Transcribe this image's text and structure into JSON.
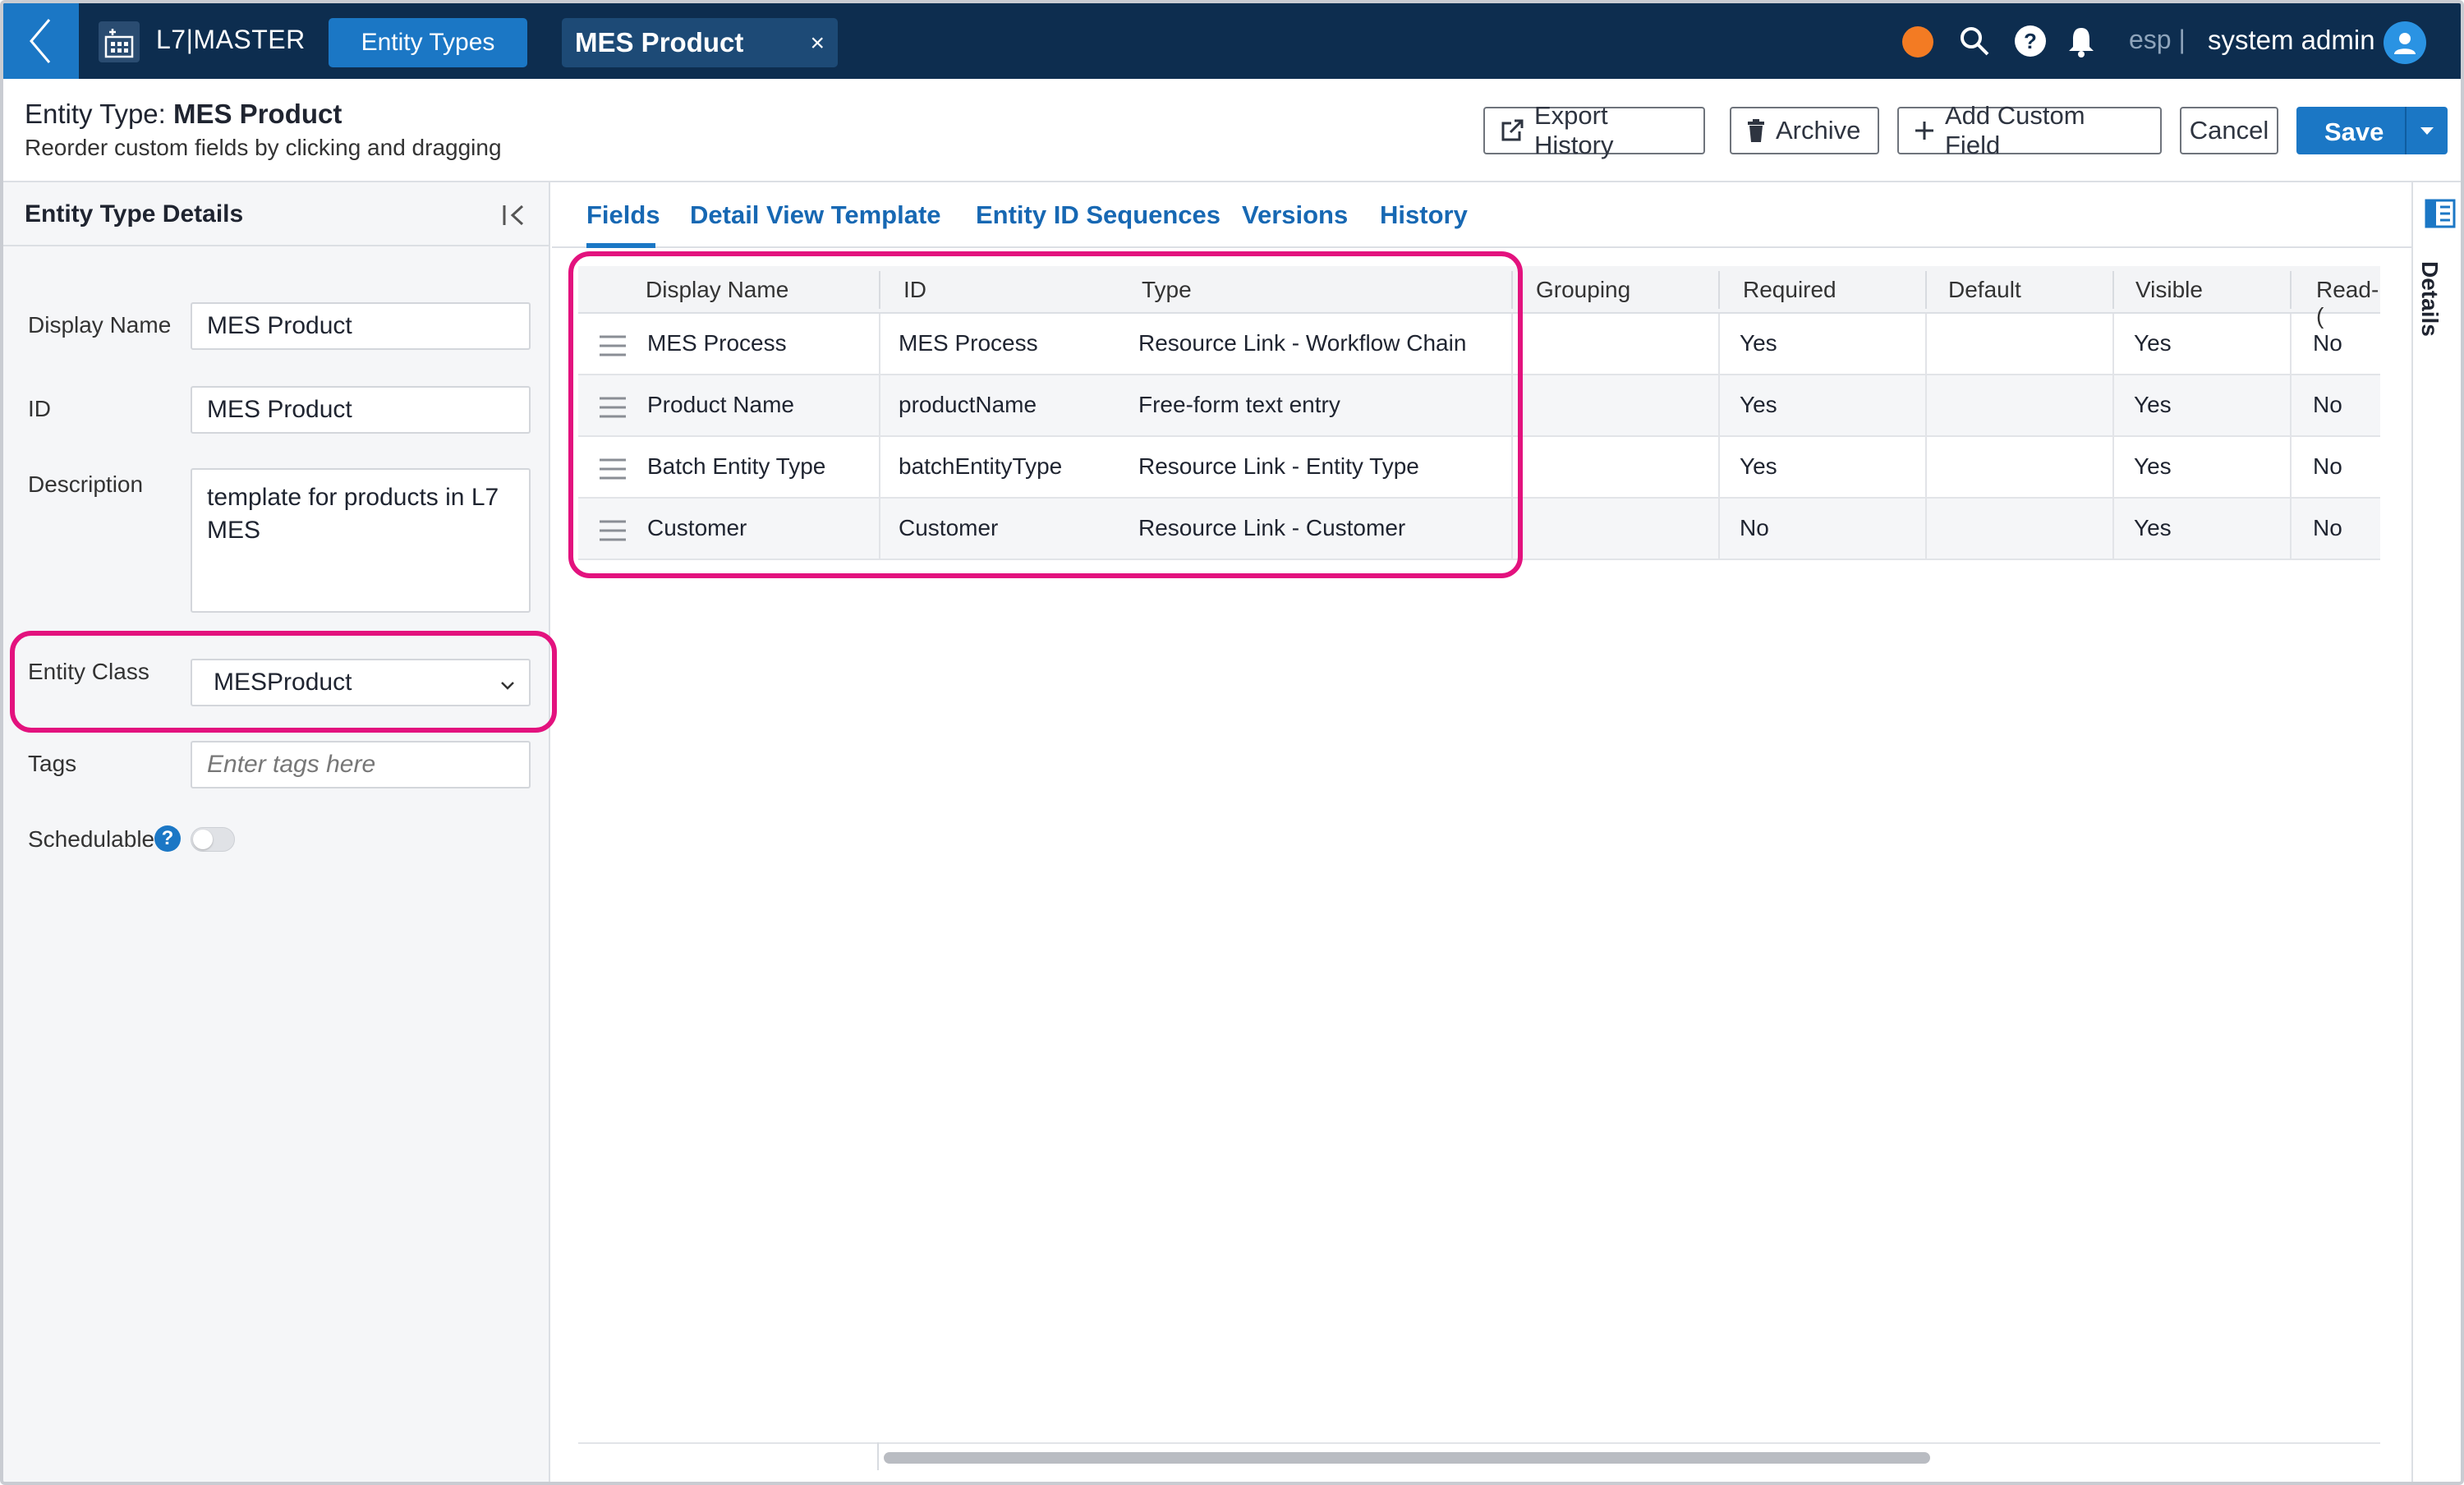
{
  "topbar": {
    "app_name": "L7|MASTER",
    "tabs": [
      {
        "label": "Entity Types"
      },
      {
        "label": "MES Product",
        "close": "×"
      }
    ],
    "lang": "esp |",
    "user": "system admin",
    "status_color": "#f37b23"
  },
  "header": {
    "title_prefix": "Entity Type:",
    "title_name": "MES Product",
    "subtitle": "Reorder custom fields by clicking and dragging",
    "buttons": {
      "export": "Export History",
      "archive": "Archive",
      "add_field": "Add Custom Field",
      "cancel": "Cancel",
      "save": "Save"
    }
  },
  "left_panel": {
    "title": "Entity Type Details",
    "fields": {
      "display_name_label": "Display Name",
      "display_name_value": "MES Product",
      "id_label": "ID",
      "id_value": "MES Product",
      "description_label": "Description",
      "description_value": "template for products in L7 MES",
      "entity_class_label": "Entity Class",
      "entity_class_value": "MESProduct",
      "tags_label": "Tags",
      "tags_placeholder": "Enter tags here",
      "schedulable_label": "Schedulable",
      "help_glyph": "?"
    }
  },
  "content_tabs": [
    "Fields",
    "Detail View Template",
    "Entity ID Sequences",
    "Versions",
    "History"
  ],
  "table": {
    "columns": [
      "Display Name",
      "ID",
      "Type",
      "Grouping",
      "Required",
      "Default",
      "Visible",
      "Read-("
    ],
    "rows": [
      {
        "display_name": "MES Process",
        "id": "MES Process",
        "type": "Resource Link - Workflow Chain",
        "grouping": "",
        "required": "Yes",
        "default": "",
        "visible": "Yes",
        "read_only": "No"
      },
      {
        "display_name": "Product Name",
        "id": "productName",
        "type": "Free-form text entry",
        "grouping": "",
        "required": "Yes",
        "default": "",
        "visible": "Yes",
        "read_only": "No"
      },
      {
        "display_name": "Batch Entity Type",
        "id": "batchEntityType",
        "type": "Resource Link - Entity Type",
        "grouping": "",
        "required": "Yes",
        "default": "",
        "visible": "Yes",
        "read_only": "No"
      },
      {
        "display_name": "Customer",
        "id": "Customer",
        "type": "Resource Link - Customer",
        "grouping": "",
        "required": "No",
        "default": "",
        "visible": "Yes",
        "read_only": "No"
      }
    ]
  },
  "right_rail": {
    "label": "Details"
  },
  "colors": {
    "topbar": "#0d2d4f",
    "accent": "#1b77c5",
    "highlight": "#e3127e"
  }
}
